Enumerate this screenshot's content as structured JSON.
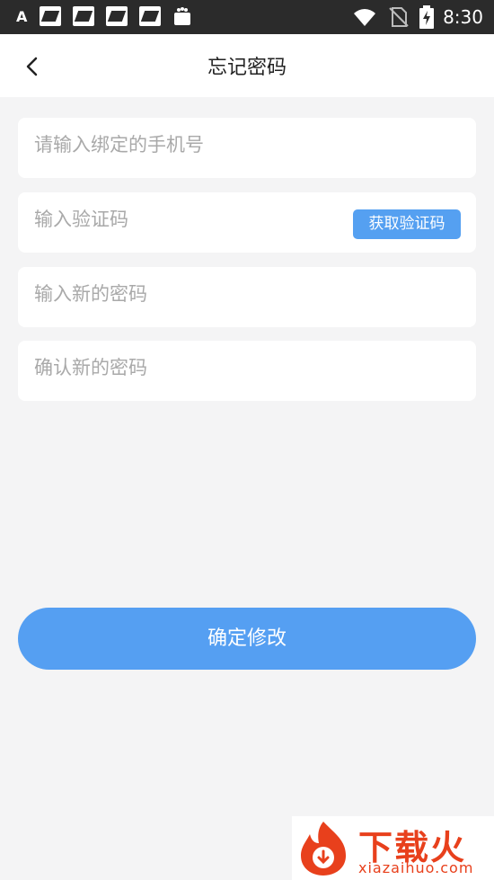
{
  "status_bar": {
    "left_label": "A",
    "time": "8:30",
    "icons": [
      "app-notification-icon",
      "app-notification-icon",
      "app-notification-icon",
      "app-notification-icon",
      "shopping-bag-icon",
      "wifi-icon",
      "no-sim-icon",
      "battery-charging-icon"
    ]
  },
  "nav": {
    "title": "忘记密码",
    "back_icon": "chevron-left-icon"
  },
  "form": {
    "phone_placeholder": "请输入绑定的手机号",
    "code_placeholder": "输入验证码",
    "get_code_label": "获取验证码",
    "new_password_placeholder": "输入新的密码",
    "confirm_password_placeholder": "确认新的密码",
    "submit_label": "确定修改"
  },
  "watermark": {
    "title": "下载火",
    "url": "xiazaihuo.com"
  },
  "colors": {
    "accent": "#559ff2",
    "background": "#f4f4f5",
    "status_bar": "#2b2b2b",
    "watermark": "#e8401c"
  }
}
